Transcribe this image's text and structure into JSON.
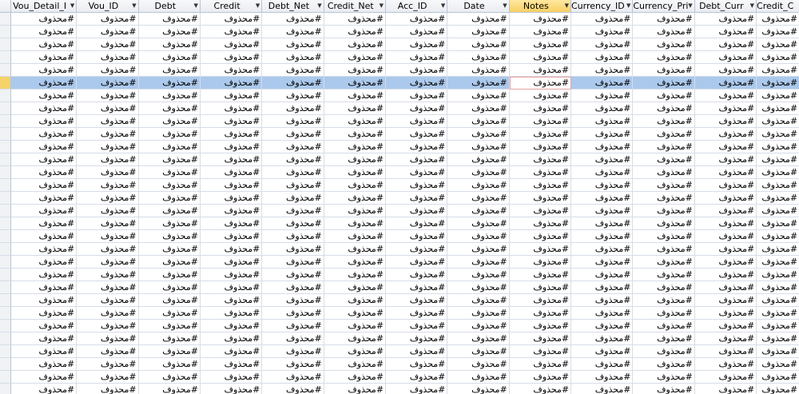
{
  "columns": [
    "Vou_Detail_I",
    "Vou_ID",
    "Debt",
    "Credit",
    "Debt_Net",
    "Credit_Net",
    "Acc_ID",
    "Date",
    "Notes",
    "Currency_ID",
    "Currency_Pri",
    "Debt_Curr",
    "Credit_C"
  ],
  "header_arrow": "▼",
  "active_column": "Notes",
  "cell_value": "#محذوف",
  "row_count": 31,
  "selected_row": 5,
  "colors": {
    "header_bg": "#eceff4",
    "active_header_bg": "#f8cf64",
    "selected_row_bg": "#abc9ec",
    "row_selector_current": "#f6d26a",
    "focused_cell_border": "#e6a0a0"
  }
}
